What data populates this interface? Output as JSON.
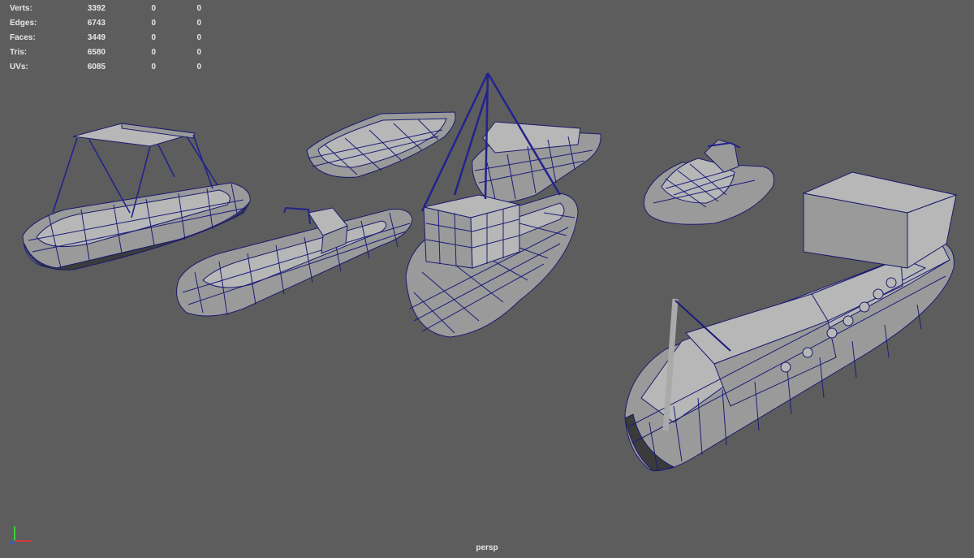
{
  "hud": {
    "rows": [
      {
        "label": "Verts:",
        "v1": "3392",
        "v2": "0",
        "v3": "0"
      },
      {
        "label": "Edges:",
        "v1": "6743",
        "v2": "0",
        "v3": "0"
      },
      {
        "label": "Faces:",
        "v1": "3449",
        "v2": "0",
        "v3": "0"
      },
      {
        "label": "Tris:",
        "v1": "6580",
        "v2": "0",
        "v3": "0"
      },
      {
        "label": "UVs:",
        "v1": "6085",
        "v2": "0",
        "v3": "0"
      }
    ]
  },
  "viewport": {
    "camera_label": "persp",
    "background": "#5d5d5d",
    "wire_color": "#1c1c7a"
  },
  "axis": {
    "x_color": "#d23a3a",
    "y_color": "#3ad23a",
    "z_color": "#3a5ad2"
  }
}
